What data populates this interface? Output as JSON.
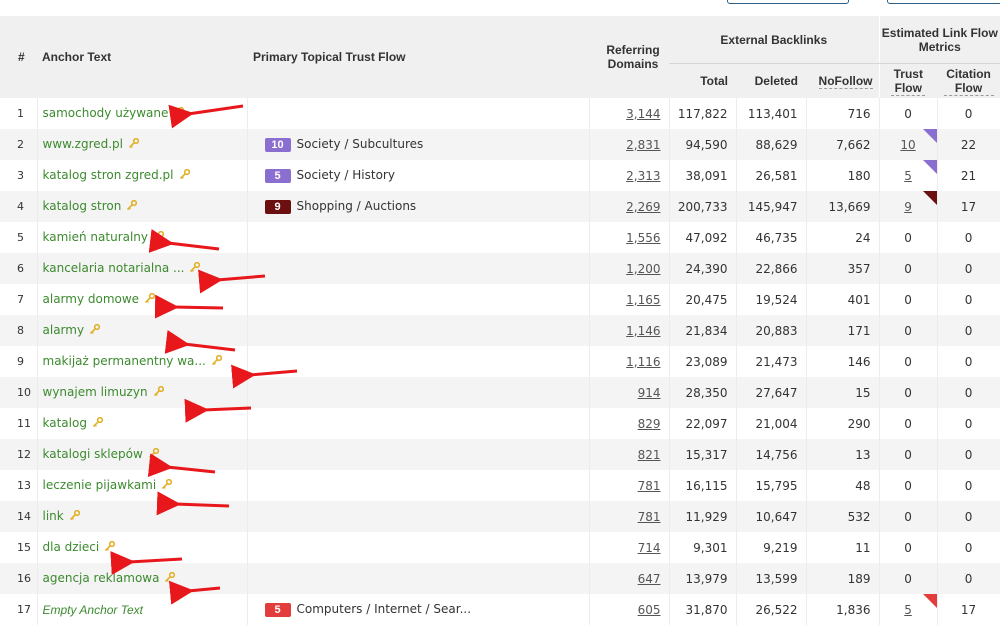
{
  "colors": {
    "anchor_green": "#3c8a2e",
    "header_bg": "#f0f0f0",
    "arrow_red": "#e8171b",
    "key_gold": "#e2b12a",
    "society": "#8b6fd0",
    "shopping": "#6b0f10",
    "computers": "#e23c3c"
  },
  "headers": {
    "index": "#",
    "anchor": "Anchor Text",
    "topical": "Primary Topical Trust Flow",
    "referring": "Referring Domains",
    "external_backlinks": "External Backlinks",
    "total": "Total",
    "deleted": "Deleted",
    "nofollow": "NoFollow",
    "estimated": "Estimated Link Flow Metrics",
    "trust_flow": "Trust Flow",
    "citation_flow": "Citation Flow"
  },
  "rows": [
    {
      "index": "1",
      "anchor": "samochody używane",
      "italic": false,
      "topic_value": "",
      "topic_label": "",
      "topic_color": "",
      "referring": "3,144",
      "total": "117,822",
      "deleted": "113,401",
      "nofollow": "716",
      "trust": "0",
      "trust_link": false,
      "citation": "0"
    },
    {
      "index": "2",
      "anchor": "www.zgred.pl",
      "italic": false,
      "topic_value": "10",
      "topic_label": "Society / Subcultures",
      "topic_color": "#8b6fd0",
      "referring": "2,831",
      "total": "94,590",
      "deleted": "88,629",
      "nofollow": "7,662",
      "trust": "10",
      "trust_link": true,
      "citation": "22"
    },
    {
      "index": "3",
      "anchor": "katalog stron zgred.pl",
      "italic": false,
      "topic_value": "5",
      "topic_label": "Society / History",
      "topic_color": "#8b6fd0",
      "referring": "2,313",
      "total": "38,091",
      "deleted": "26,581",
      "nofollow": "180",
      "trust": "5",
      "trust_link": true,
      "citation": "21"
    },
    {
      "index": "4",
      "anchor": "katalog stron",
      "italic": false,
      "topic_value": "9",
      "topic_label": "Shopping / Auctions",
      "topic_color": "#6b0f10",
      "referring": "2,269",
      "total": "200,733",
      "deleted": "145,947",
      "nofollow": "13,669",
      "trust": "9",
      "trust_link": true,
      "citation": "17"
    },
    {
      "index": "5",
      "anchor": "kamień naturalny",
      "italic": false,
      "topic_value": "",
      "topic_label": "",
      "topic_color": "",
      "referring": "1,556",
      "total": "47,092",
      "deleted": "46,735",
      "nofollow": "24",
      "trust": "0",
      "trust_link": false,
      "citation": "0"
    },
    {
      "index": "6",
      "anchor": "kancelaria notarialna ...",
      "italic": false,
      "topic_value": "",
      "topic_label": "",
      "topic_color": "",
      "referring": "1,200",
      "total": "24,390",
      "deleted": "22,866",
      "nofollow": "357",
      "trust": "0",
      "trust_link": false,
      "citation": "0"
    },
    {
      "index": "7",
      "anchor": "alarmy domowe",
      "italic": false,
      "topic_value": "",
      "topic_label": "",
      "topic_color": "",
      "referring": "1,165",
      "total": "20,475",
      "deleted": "19,524",
      "nofollow": "401",
      "trust": "0",
      "trust_link": false,
      "citation": "0"
    },
    {
      "index": "8",
      "anchor": "alarmy",
      "italic": false,
      "topic_value": "",
      "topic_label": "",
      "topic_color": "",
      "referring": "1,146",
      "total": "21,834",
      "deleted": "20,883",
      "nofollow": "171",
      "trust": "0",
      "trust_link": false,
      "citation": "0"
    },
    {
      "index": "9",
      "anchor": "makijaż permanentny wa...",
      "italic": false,
      "topic_value": "",
      "topic_label": "",
      "topic_color": "",
      "referring": "1,116",
      "total": "23,089",
      "deleted": "21,473",
      "nofollow": "146",
      "trust": "0",
      "trust_link": false,
      "citation": "0"
    },
    {
      "index": "10",
      "anchor": "wynajem limuzyn",
      "italic": false,
      "topic_value": "",
      "topic_label": "",
      "topic_color": "",
      "referring": "914",
      "total": "28,350",
      "deleted": "27,647",
      "nofollow": "15",
      "trust": "0",
      "trust_link": false,
      "citation": "0"
    },
    {
      "index": "11",
      "anchor": "katalog",
      "italic": false,
      "topic_value": "",
      "topic_label": "",
      "topic_color": "",
      "referring": "829",
      "total": "22,097",
      "deleted": "21,004",
      "nofollow": "290",
      "trust": "0",
      "trust_link": false,
      "citation": "0"
    },
    {
      "index": "12",
      "anchor": "katalogi sklepów",
      "italic": false,
      "topic_value": "",
      "topic_label": "",
      "topic_color": "",
      "referring": "821",
      "total": "15,317",
      "deleted": "14,756",
      "nofollow": "13",
      "trust": "0",
      "trust_link": false,
      "citation": "0"
    },
    {
      "index": "13",
      "anchor": "leczenie pijawkami",
      "italic": false,
      "topic_value": "",
      "topic_label": "",
      "topic_color": "",
      "referring": "781",
      "total": "16,115",
      "deleted": "15,795",
      "nofollow": "48",
      "trust": "0",
      "trust_link": false,
      "citation": "0"
    },
    {
      "index": "14",
      "anchor": "link",
      "italic": false,
      "topic_value": "",
      "topic_label": "",
      "topic_color": "",
      "referring": "781",
      "total": "11,929",
      "deleted": "10,647",
      "nofollow": "532",
      "trust": "0",
      "trust_link": false,
      "citation": "0"
    },
    {
      "index": "15",
      "anchor": "dla dzieci",
      "italic": false,
      "topic_value": "",
      "topic_label": "",
      "topic_color": "",
      "referring": "714",
      "total": "9,301",
      "deleted": "9,219",
      "nofollow": "11",
      "trust": "0",
      "trust_link": false,
      "citation": "0"
    },
    {
      "index": "16",
      "anchor": "agencja reklamowa",
      "italic": false,
      "topic_value": "",
      "topic_label": "",
      "topic_color": "",
      "referring": "647",
      "total": "13,979",
      "deleted": "13,599",
      "nofollow": "189",
      "trust": "0",
      "trust_link": false,
      "citation": "0"
    },
    {
      "index": "17",
      "anchor": "Empty Anchor Text",
      "italic": true,
      "topic_value": "5",
      "topic_label": "Computers / Internet / Sear...",
      "topic_color": "#e23c3c",
      "referring": "605",
      "total": "31,870",
      "deleted": "26,522",
      "nofollow": "1,836",
      "trust": "5",
      "trust_link": true,
      "citation": "17"
    }
  ]
}
